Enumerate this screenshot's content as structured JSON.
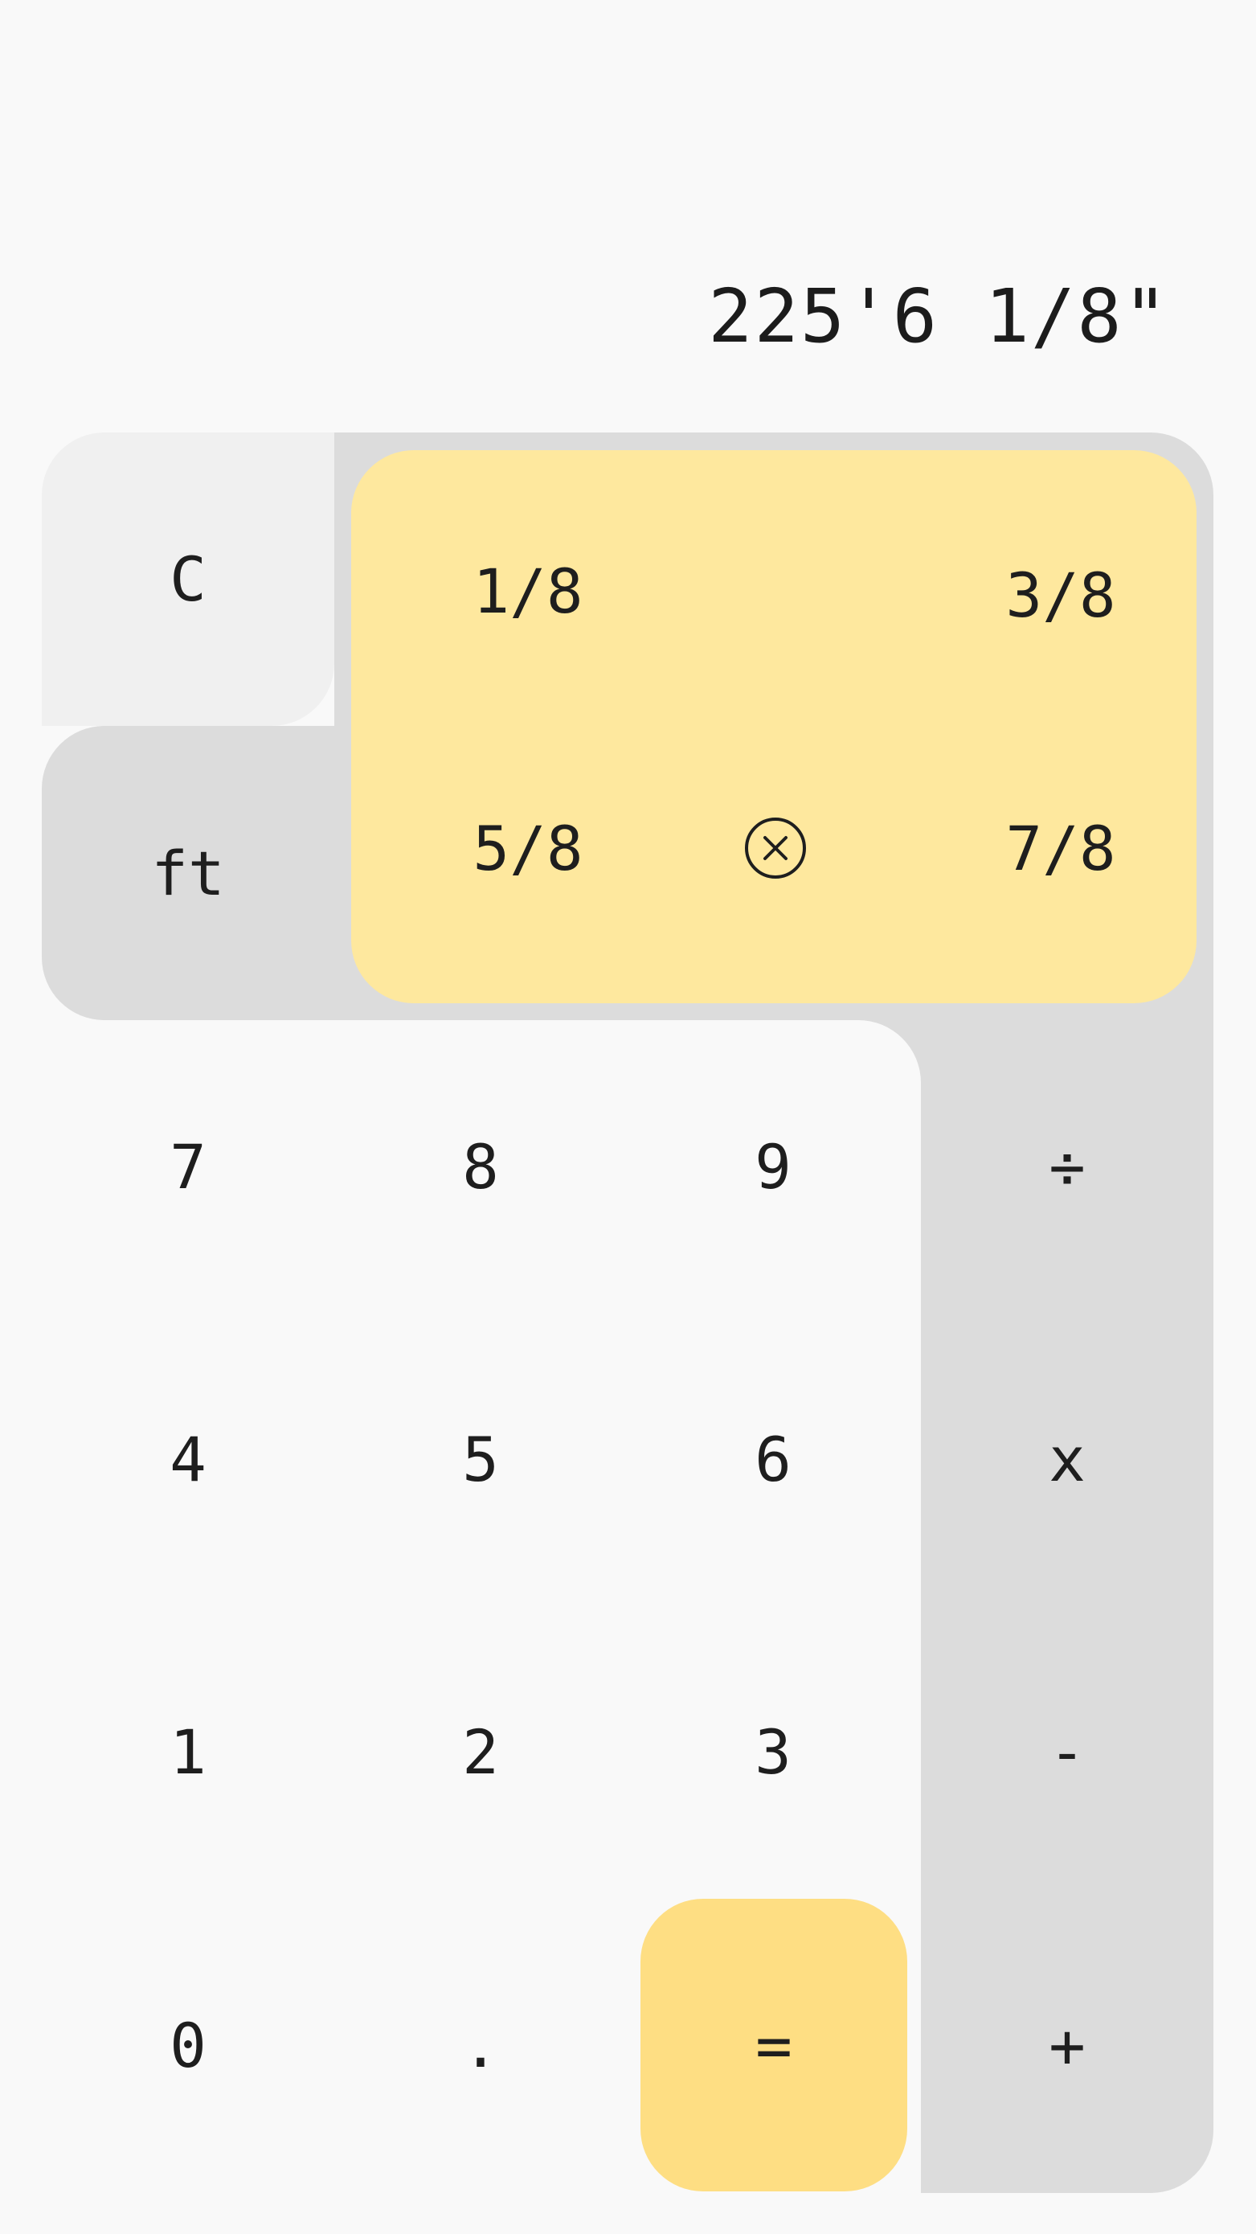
{
  "display": {
    "value": "225'6 1/8\""
  },
  "keys": {
    "clear": "C",
    "unit": "ft",
    "frac_1_8": "1/8",
    "frac_3_8": "3/8",
    "frac_5_8": "5/8",
    "frac_7_8": "7/8",
    "close_icon": "close-circle",
    "seven": "7",
    "eight": "8",
    "nine": "9",
    "divide": "÷",
    "four": "4",
    "five": "5",
    "six": "6",
    "multiply": "x",
    "one": "1",
    "two": "2",
    "three": "3",
    "minus": "-",
    "zero": "0",
    "dot": ".",
    "equals": "=",
    "plus": "+"
  },
  "colors": {
    "background": "#f9f9f9",
    "panel_gray": "#dcdcdc",
    "panel_light": "#f0f0f0",
    "fraction_yellow": "#fee89e",
    "equals_yellow": "#fede83"
  }
}
